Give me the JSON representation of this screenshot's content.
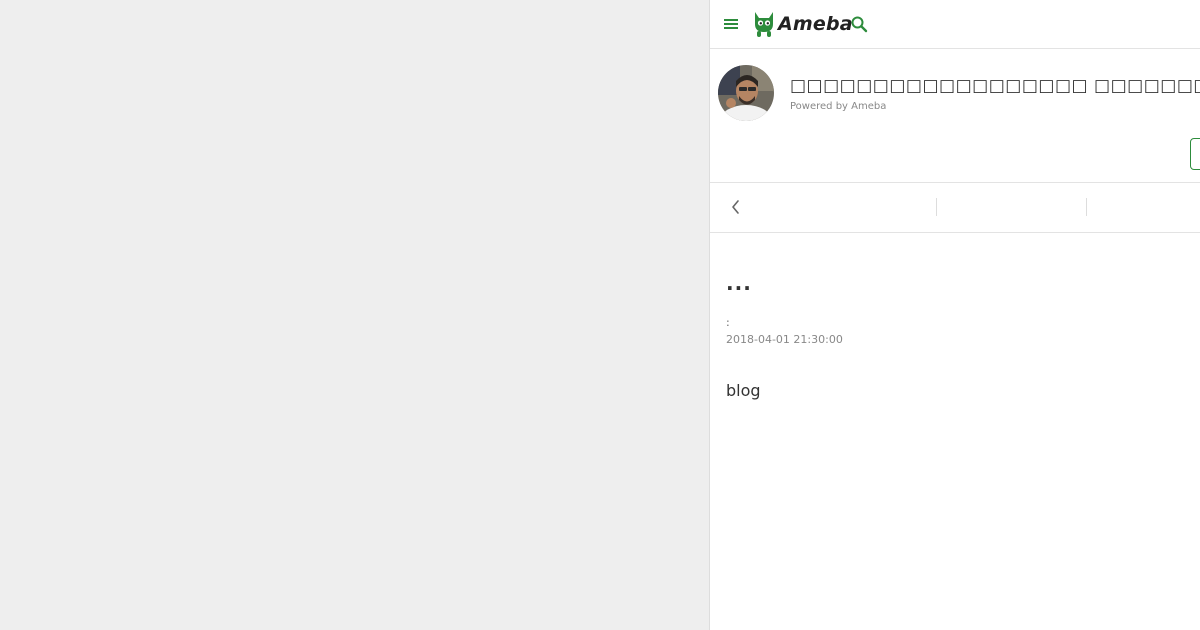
{
  "header": {
    "logo_text": "Ameba",
    "menu_icon": "hamburger-menu-icon",
    "search_icon": "search-icon",
    "accent_color": "#2d8c3c"
  },
  "profile": {
    "blog_title": "□□□□□□□□□□□□□□□□□□ □□□□□□□□□□□□□□",
    "powered_by": "Powered by Ameba"
  },
  "nav": {
    "back_icon": "chevron-left-icon"
  },
  "entry": {
    "title": "...",
    "theme": ":",
    "date": "2018-04-01 21:30:00",
    "body": "blog"
  }
}
